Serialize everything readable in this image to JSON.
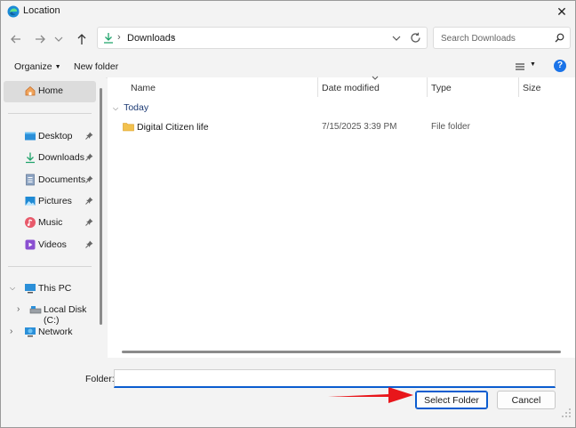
{
  "window": {
    "title": "Location",
    "close_glyph": "✕"
  },
  "nav": {
    "back": "arrow-left-icon",
    "forward": "arrow-right-icon",
    "recent": "chevron-down-icon",
    "up": "arrow-up-icon",
    "address": {
      "separator": "›",
      "crumbs": [
        "Downloads"
      ]
    },
    "search": {
      "placeholder": "Search Downloads"
    }
  },
  "commands": {
    "organize": "Organize",
    "new_folder": "New folder",
    "help": "?"
  },
  "sidebar": {
    "home": "Home",
    "quick_access": [
      {
        "label": "Desktop",
        "icon": "desktop-icon"
      },
      {
        "label": "Downloads",
        "icon": "download-icon"
      },
      {
        "label": "Documents",
        "icon": "documents-icon"
      },
      {
        "label": "Pictures",
        "icon": "pictures-icon"
      },
      {
        "label": "Music",
        "icon": "music-icon"
      },
      {
        "label": "Videos",
        "icon": "videos-icon"
      }
    ],
    "this_pc": "This PC",
    "local_disk": "Local Disk (C:)",
    "network": "Network"
  },
  "columns": {
    "name": "Name",
    "date": "Date modified",
    "type": "Type",
    "size": "Size"
  },
  "groups": [
    {
      "label": "Today",
      "items": [
        {
          "name": "Digital Citizen life",
          "date": "7/15/2025 3:39 PM",
          "type": "File folder"
        }
      ]
    }
  ],
  "footer": {
    "folder_label": "Folder:",
    "folder_value": "",
    "select_button": "Select Folder",
    "cancel_button": "Cancel"
  },
  "colors": {
    "accent": "#0a5ccf",
    "arrow": "#e8161b",
    "folder": "#f2c14e"
  }
}
